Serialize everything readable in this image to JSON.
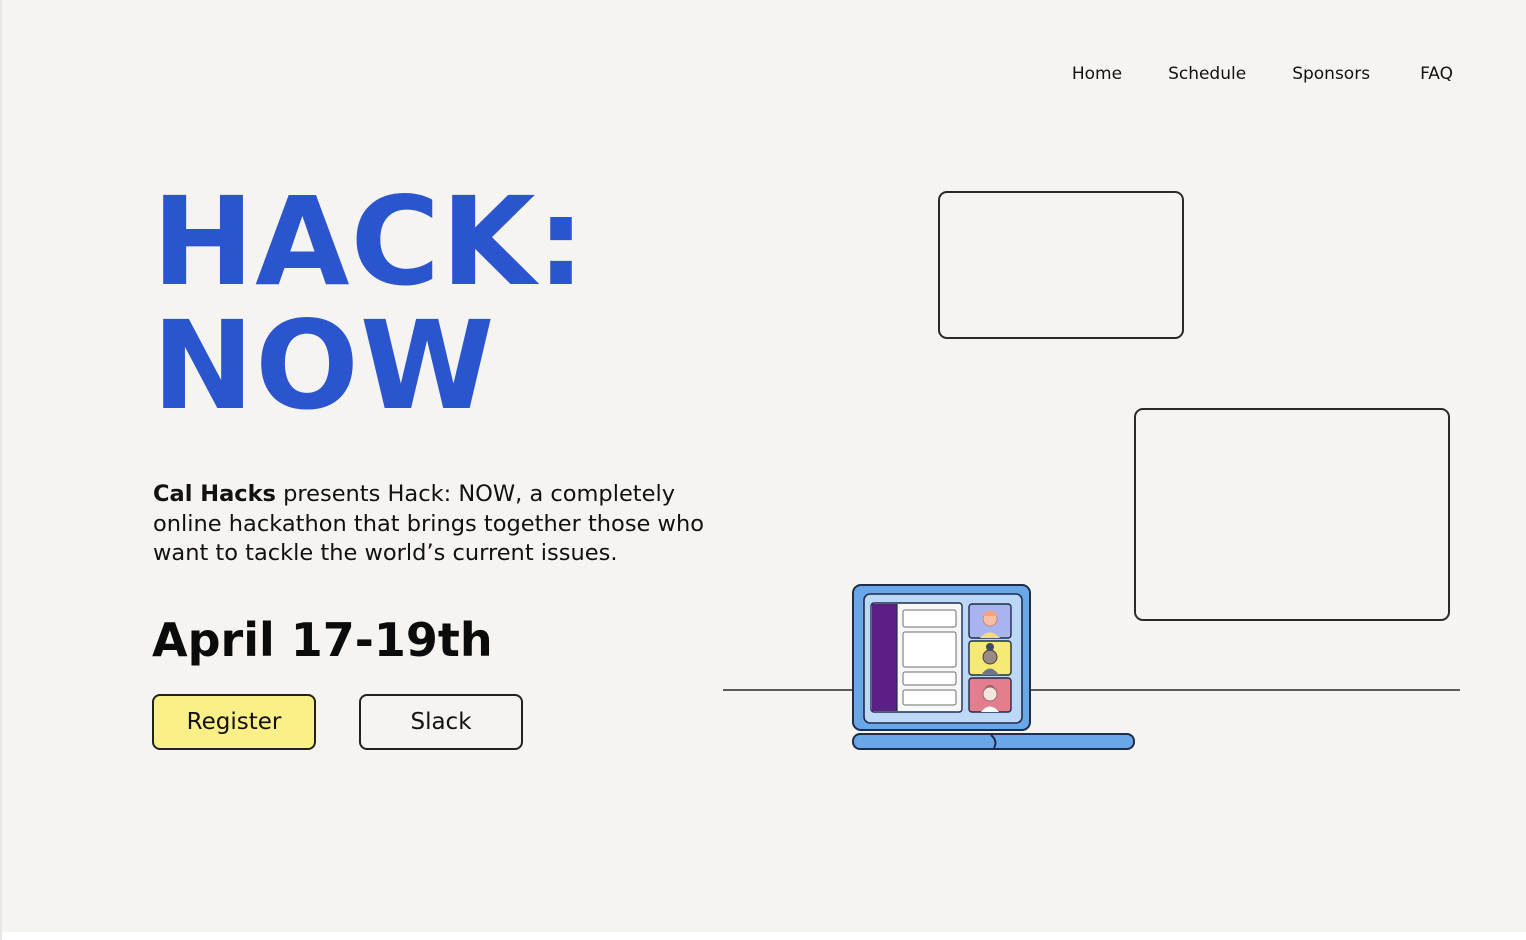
{
  "nav": {
    "items": [
      {
        "label": "Home"
      },
      {
        "label": "Schedule"
      },
      {
        "label": "Sponsors"
      },
      {
        "label": "FAQ"
      }
    ]
  },
  "hero": {
    "title_line1": "HACK:",
    "title_line2": "NOW",
    "description_bold": "Cal Hacks",
    "description_rest": " presents Hack: NOW, a completely online hackathon that brings together those who want to tackle the world’s current issues.",
    "date": "April 17-19th"
  },
  "buttons": {
    "register_label": "Register",
    "slack_label": "Slack"
  },
  "colors": {
    "background": "#f5f4f1",
    "title_blue": "#2b55cf",
    "register_yellow": "#fbef87",
    "laptop_blue": "#6aa7e8",
    "screen_purple": "#5b1f86"
  },
  "illustration": {
    "icons": [
      "video-frame",
      "video-frame",
      "laptop-icon",
      "video-call-avatar"
    ]
  }
}
